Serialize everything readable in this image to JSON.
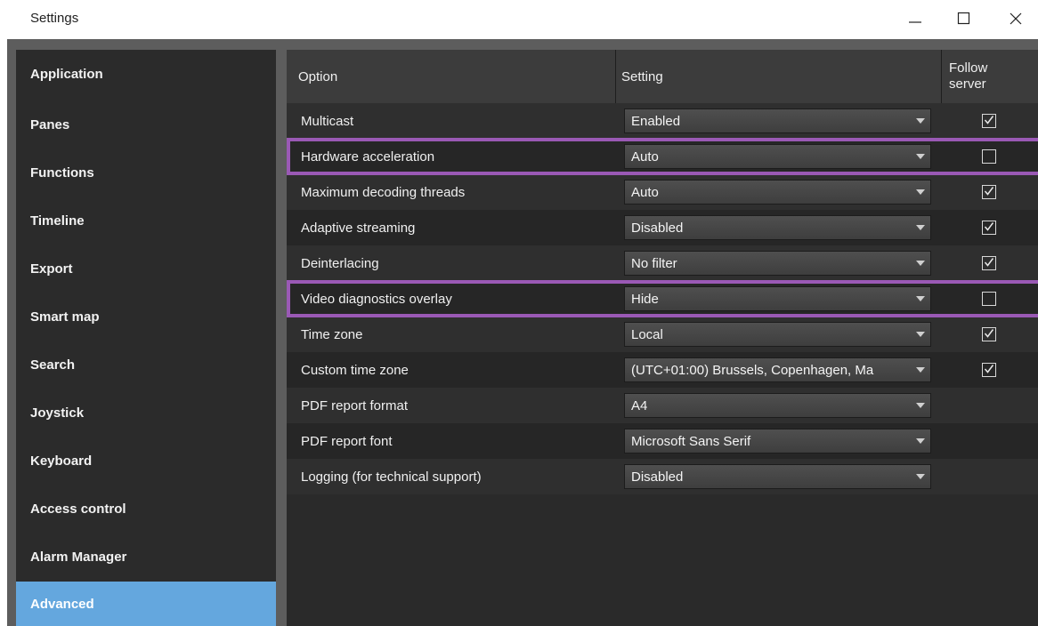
{
  "window": {
    "title": "Settings",
    "controls": [
      "minimize-icon",
      "maximize-icon",
      "close-icon"
    ]
  },
  "sidebar": {
    "items": [
      {
        "label": "Application"
      },
      {
        "label": "Panes"
      },
      {
        "label": "Functions"
      },
      {
        "label": "Timeline"
      },
      {
        "label": "Export"
      },
      {
        "label": "Smart map"
      },
      {
        "label": "Search"
      },
      {
        "label": "Joystick"
      },
      {
        "label": "Keyboard"
      },
      {
        "label": "Access control"
      },
      {
        "label": "Alarm Manager"
      },
      {
        "label": "Advanced",
        "active": true
      }
    ]
  },
  "table": {
    "headers": {
      "option": "Option",
      "setting": "Setting",
      "follow_line1": "Follow",
      "follow_line2": "server"
    },
    "rows": [
      {
        "option": "Multicast",
        "setting": "Enabled",
        "follow": true,
        "show_checkbox": true,
        "highlighted": false
      },
      {
        "option": "Hardware acceleration",
        "setting": "Auto",
        "follow": false,
        "show_checkbox": true,
        "highlighted": true
      },
      {
        "option": "Maximum decoding threads",
        "setting": "Auto",
        "follow": true,
        "show_checkbox": true,
        "highlighted": false
      },
      {
        "option": "Adaptive streaming",
        "setting": "Disabled",
        "follow": true,
        "show_checkbox": true,
        "highlighted": false
      },
      {
        "option": "Deinterlacing",
        "setting": "No filter",
        "follow": true,
        "show_checkbox": true,
        "highlighted": false
      },
      {
        "option": "Video diagnostics overlay",
        "setting": "Hide",
        "follow": false,
        "show_checkbox": true,
        "highlighted": true
      },
      {
        "option": "Time zone",
        "setting": "Local",
        "follow": true,
        "show_checkbox": true,
        "highlighted": false
      },
      {
        "option": "Custom time zone",
        "setting": "(UTC+01:00) Brussels, Copenhagen, Ma",
        "follow": true,
        "show_checkbox": true,
        "highlighted": false
      },
      {
        "option": "PDF report format",
        "setting": "A4",
        "follow": false,
        "show_checkbox": false,
        "highlighted": false
      },
      {
        "option": "PDF report font",
        "setting": "Microsoft Sans Serif",
        "follow": false,
        "show_checkbox": false,
        "highlighted": false
      },
      {
        "option": "Logging (for technical support)",
        "setting": "Disabled",
        "follow": false,
        "show_checkbox": false,
        "highlighted": false
      }
    ]
  },
  "colors": {
    "sidebar_bg": "#2b2b2b",
    "active_item": "#64a7de",
    "highlight_outline": "#9a59b5",
    "panel_bg": "#2a2a2a"
  }
}
